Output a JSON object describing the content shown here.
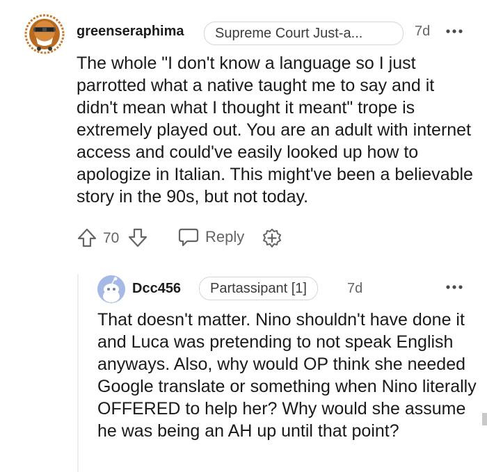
{
  "comments": [
    {
      "username": "greenseraphima",
      "flair": "Supreme Court Just-a...",
      "timestamp": "7d",
      "body": "The whole \"I don't know a language so I just parrotted what a native taught me to say and it didn't mean what I thought it meant\" trope is extremely played out. You are an adult with internet access and could've easily looked up how to apologize in Italian. This might've been a believable story in the 90s, but not today.",
      "score": "70",
      "reply_label": "Reply",
      "avatar_icon": "cartoon-avatar-icon"
    },
    {
      "username": "Dcc456",
      "flair": "Partassipant [1]",
      "timestamp": "7d",
      "body": "That doesn't matter. Nino shouldn't have done it and Luca was pretending to not speak English anyways. Also, why would OP think she needed Google translate or something when Nino literally OFFERED to help her? Why would she assume he was being an AH up until that point?",
      "avatar_icon": "default-snoo-avatar-icon"
    }
  ],
  "colors": {
    "text": "#1a1a1b",
    "meta": "#636466",
    "flair_border": "#d4d6d9",
    "thread_line": "#edeff1"
  }
}
